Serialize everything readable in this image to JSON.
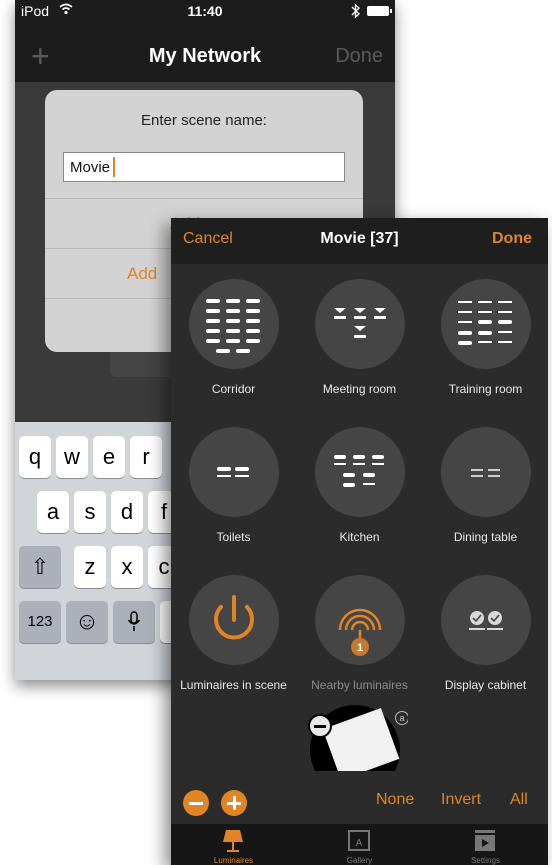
{
  "back": {
    "status": {
      "carrier": "iPod",
      "time": "11:40"
    },
    "nav": {
      "add_symbol": "+",
      "title": "My Network",
      "done": "Done"
    },
    "dialog": {
      "prompt": "Enter scene name:",
      "input_value": "Movie",
      "option1": "Add to ...",
      "option2": "Add"
    },
    "keyboard": {
      "row1": [
        "q",
        "w",
        "e",
        "r"
      ],
      "row2": [
        "a",
        "s",
        "d",
        "f"
      ],
      "row3": [
        "z",
        "x",
        "c"
      ],
      "shift": "⇧",
      "numbers": "123",
      "emoji": "☺",
      "mic": "🎙"
    }
  },
  "front": {
    "nav": {
      "cancel": "Cancel",
      "title": "Movie [37]",
      "done": "Done"
    },
    "tiles": [
      {
        "label": "Corridor",
        "icon": "corridor-luminaires-icon"
      },
      {
        "label": "Meeting room",
        "icon": "meeting-room-luminaires-icon"
      },
      {
        "label": "Training room",
        "icon": "training-room-luminaires-icon"
      },
      {
        "label": "Toilets",
        "icon": "toilets-luminaires-icon"
      },
      {
        "label": "Kitchen",
        "icon": "kitchen-luminaires-icon"
      },
      {
        "label": "Dining table",
        "icon": "dining-table-luminaires-icon"
      },
      {
        "label": "Luminaires in scene",
        "icon": "power-icon"
      },
      {
        "label": "Nearby luminaires",
        "icon": "nearby-signal-icon",
        "badge": "1"
      },
      {
        "label": "Display cabinet",
        "icon": "display-cabinet-icon"
      }
    ],
    "bottom": {
      "none": "None",
      "invert": "Invert",
      "all": "All"
    },
    "tabs": [
      {
        "label": "Luminaires",
        "icon": "lamp-icon",
        "active": true
      },
      {
        "label": "Gallery",
        "icon": "gallery-icon",
        "active": false
      },
      {
        "label": "Settings",
        "icon": "settings-icon",
        "active": false
      }
    ],
    "accent": "#e08424"
  }
}
